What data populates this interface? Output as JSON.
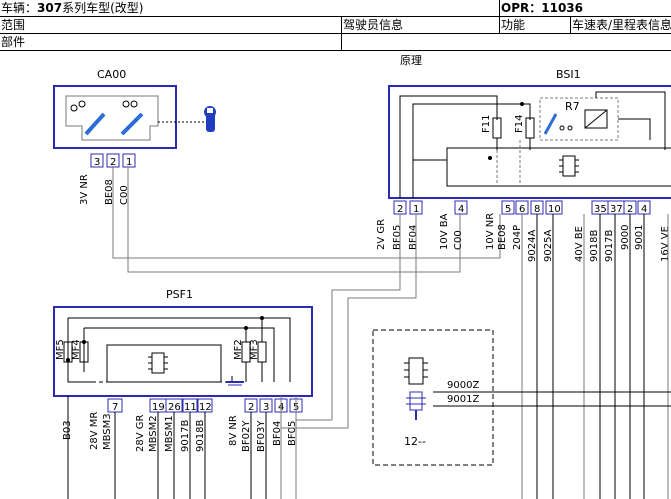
{
  "header": {
    "vehicle_prefix": "车辆",
    "vehicle_sep": "：",
    "vehicle_model": "307",
    "vehicle_suffix": "系列车型(改型)",
    "opr_label": "OPR：",
    "opr_number": "11036",
    "scope_label": "范围",
    "scope_value": "驾驶员信息",
    "function_label": "功能",
    "function_value": "车速表/里程表信息",
    "part_label": "部件"
  },
  "diagram": {
    "section_title": "原理",
    "components": {
      "ca00": "CA00",
      "bsi1": "BSI1",
      "psf1": "PSF1",
      "unit12": "12--"
    },
    "relays": [
      "R7"
    ],
    "fuses_bsi": [
      "F11",
      "F14"
    ],
    "fuses_psf_left": [
      "MF5",
      "MF4"
    ],
    "fuses_psf_right": [
      "MF2",
      "MF3"
    ],
    "ca00_pins": [
      "3",
      "2",
      "1"
    ],
    "ca00_wires": [
      "3V NR",
      "BE08",
      "C00"
    ],
    "bsi_pins": [
      "2",
      "1",
      "4",
      "5",
      "6",
      "8",
      "10",
      "35",
      "37",
      "2",
      "4"
    ],
    "bsi_wires": [
      "2V GR",
      "BF05",
      "BF04",
      "10V BA",
      "C00",
      "10V NR",
      "BE08",
      "204P",
      "9024A",
      "9025A",
      "40V BE",
      "9018B",
      "9017B",
      "9000",
      "9001",
      "16V VE"
    ],
    "psf_pins_left": [
      "7",
      "19",
      "26",
      "11",
      "12"
    ],
    "psf_pins_right": [
      "2",
      "3",
      "4",
      "5"
    ],
    "psf_wires_left": [
      "B03",
      "28V MR",
      "MBSM3",
      "28V GR",
      "MBSM2",
      "MBSM1",
      "9017B",
      "9018B"
    ],
    "psf_wires_right": [
      "8V NR",
      "BF02Y",
      "BF03Y",
      "BF04",
      "BF05"
    ],
    "unit12_wires": [
      "9000Z",
      "9001Z"
    ]
  }
}
